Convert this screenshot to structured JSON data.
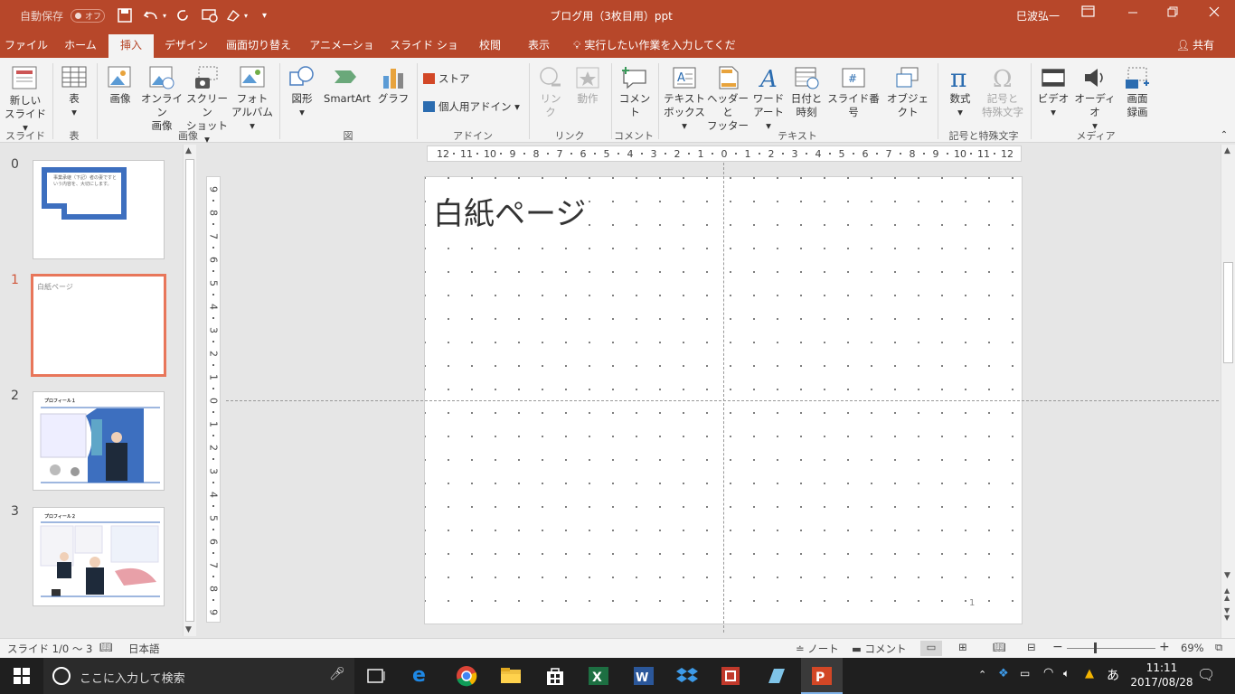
{
  "titlebar": {
    "autosave_label": "自動保存",
    "autosave_state": "オフ",
    "doc_title": "ブログ用（3枚目用）ppt",
    "user_name": "巳波弘一",
    "accent": "#b7472a"
  },
  "tabs": [
    "ファイル",
    "ホーム",
    "挿入",
    "デザイン",
    "画面切り替え",
    "アニメーション",
    "スライド ショー",
    "校閲",
    "表示"
  ],
  "active_tab": "挿入",
  "tell_me": "実行したい作業を入力してください",
  "share_label": "共有",
  "ribbon": {
    "new_slide": [
      "新しい",
      "スライド"
    ],
    "table": "表",
    "picture": "画像",
    "online_picture": [
      "オンライン",
      "画像"
    ],
    "screenshot": [
      "スクリーン",
      "ショット"
    ],
    "photo_album": [
      "フォト",
      "アルバム"
    ],
    "shapes": "図形",
    "smartart": "SmartArt",
    "chart": "グラフ",
    "store": "ストア",
    "my_addins": "個人用アドイン",
    "link": [
      "リン",
      "ク"
    ],
    "action": "動作",
    "comment": "コメント",
    "textbox": [
      "テキスト",
      "ボックス"
    ],
    "header_footer": [
      "ヘッダーと",
      "フッター"
    ],
    "wordart": [
      "ワード",
      "アート"
    ],
    "date_time": [
      "日付と",
      "時刻"
    ],
    "slide_number": "スライド番号",
    "object": "オブジェクト",
    "equation": "数式",
    "symbol": [
      "記号と",
      "特殊文字"
    ],
    "video": "ビデオ",
    "audio": "オーディオ",
    "screen_recording": [
      "画面",
      "録画"
    ],
    "groups": {
      "slides": "スライド",
      "tables": "表",
      "images": "画像",
      "illustrations": "図",
      "addins": "アドイン",
      "links": "リンク",
      "comments": "コメント",
      "text": "テキスト",
      "symbols": "記号と特殊文字",
      "media": "メディア"
    }
  },
  "thumbnails": [
    {
      "num": "0",
      "text": "事業承継（下記）者の妻ですという内容を、大切にします。"
    },
    {
      "num": "1",
      "text": "白紙ページ"
    },
    {
      "num": "2",
      "text": "プロフィール１"
    },
    {
      "num": "3",
      "text": "プロフィール２"
    }
  ],
  "slide": {
    "title": "白紙ページ",
    "page_number": "1"
  },
  "ruler_h": [
    "12",
    "11",
    "10",
    "9",
    "8",
    "7",
    "6",
    "5",
    "4",
    "3",
    "2",
    "1",
    "0",
    "1",
    "2",
    "3",
    "4",
    "5",
    "6",
    "7",
    "8",
    "9",
    "10",
    "11",
    "12"
  ],
  "ruler_v": [
    "9",
    "8",
    "7",
    "6",
    "5",
    "4",
    "3",
    "2",
    "1",
    "0",
    "1",
    "2",
    "3",
    "4",
    "5",
    "6",
    "7",
    "8",
    "9"
  ],
  "status": {
    "slide_info": "スライド 1/0 ～ 3",
    "language": "日本語",
    "notes": "ノート",
    "comments": "コメント",
    "zoom": "69%"
  },
  "taskbar": {
    "search_placeholder": "ここに入力して検索",
    "ime": "あ",
    "time": "11:11",
    "date": "2017/08/28"
  }
}
